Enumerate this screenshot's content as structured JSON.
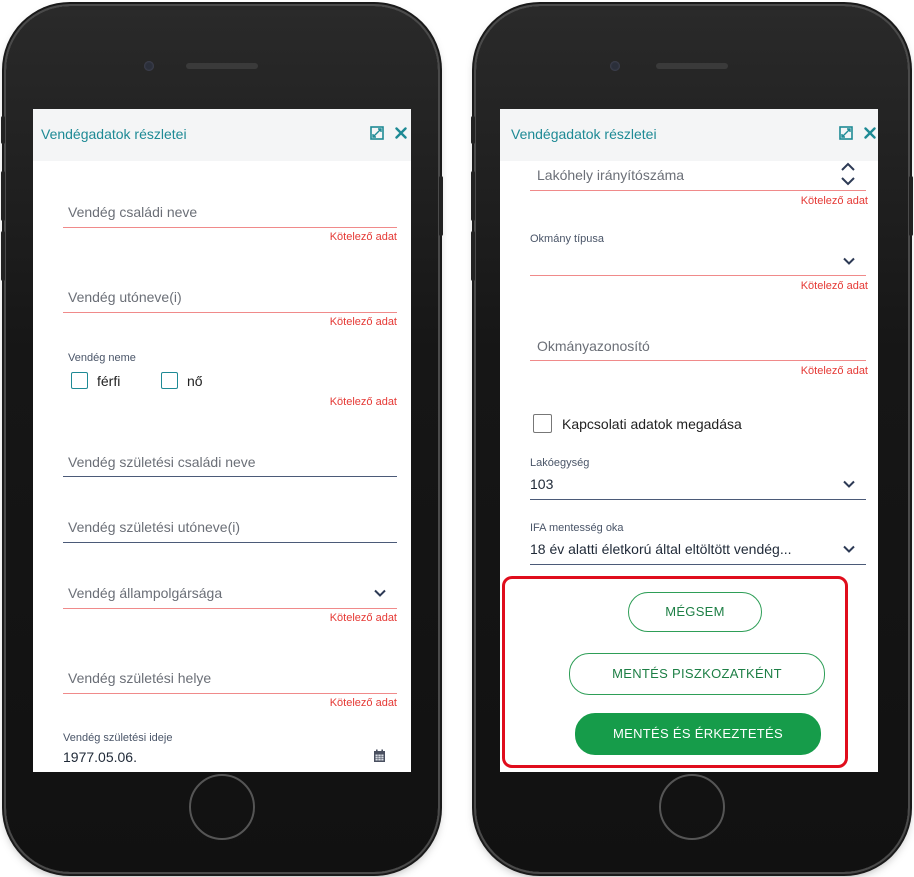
{
  "header": {
    "title": "Vendégadatok részletei"
  },
  "icons": {
    "expand": "expand-icon",
    "close": "close-icon",
    "chevron": "chevron-down-icon",
    "calendar": "calendar-icon",
    "spinner": "spinner-arrows-icon"
  },
  "colors": {
    "accent": "#1e8a95",
    "error": "#e53935",
    "success": "#169c4a",
    "highlight": "#e00d1c"
  },
  "left_form": {
    "family_name": {
      "placeholder": "Vendég családi neve",
      "error": "Kötelező adat"
    },
    "given_names": {
      "placeholder": "Vendég utóneve(i)",
      "error": "Kötelező adat"
    },
    "gender": {
      "label": "Vendég neme",
      "options": [
        "férfi",
        "nő"
      ],
      "error": "Kötelező adat"
    },
    "birth_family_name": {
      "placeholder": "Vendég születési családi neve"
    },
    "birth_given_names": {
      "placeholder": "Vendég születési utóneve(i)"
    },
    "citizenship": {
      "placeholder": "Vendég állampolgársága",
      "error": "Kötelező adat"
    },
    "birth_place": {
      "placeholder": "Vendég születési helye",
      "error": "Kötelező adat"
    },
    "birth_date": {
      "label": "Vendég születési ideje",
      "value": "1977.05.06."
    }
  },
  "right_form": {
    "postal_code": {
      "placeholder": "Lakóhely irányítószáma",
      "error": "Kötelező adat"
    },
    "document_type": {
      "label": "Okmány típusa",
      "error": "Kötelező adat"
    },
    "document_id": {
      "placeholder": "Okmányazonosító",
      "error": "Kötelező adat"
    },
    "contact_checkbox": {
      "label": "Kapcsolati adatok megadása"
    },
    "unit": {
      "label": "Lakóegység",
      "value": "103"
    },
    "vat_exemption": {
      "label": "IFA mentesség oka",
      "value": "18 év alatti életkorú által eltöltött vendég..."
    }
  },
  "buttons": {
    "cancel": "MÉGSEM",
    "save_draft": "MENTÉS PISZKOZATKÉNT",
    "save_checkin": "MENTÉS ÉS ÉRKEZTETÉS"
  }
}
